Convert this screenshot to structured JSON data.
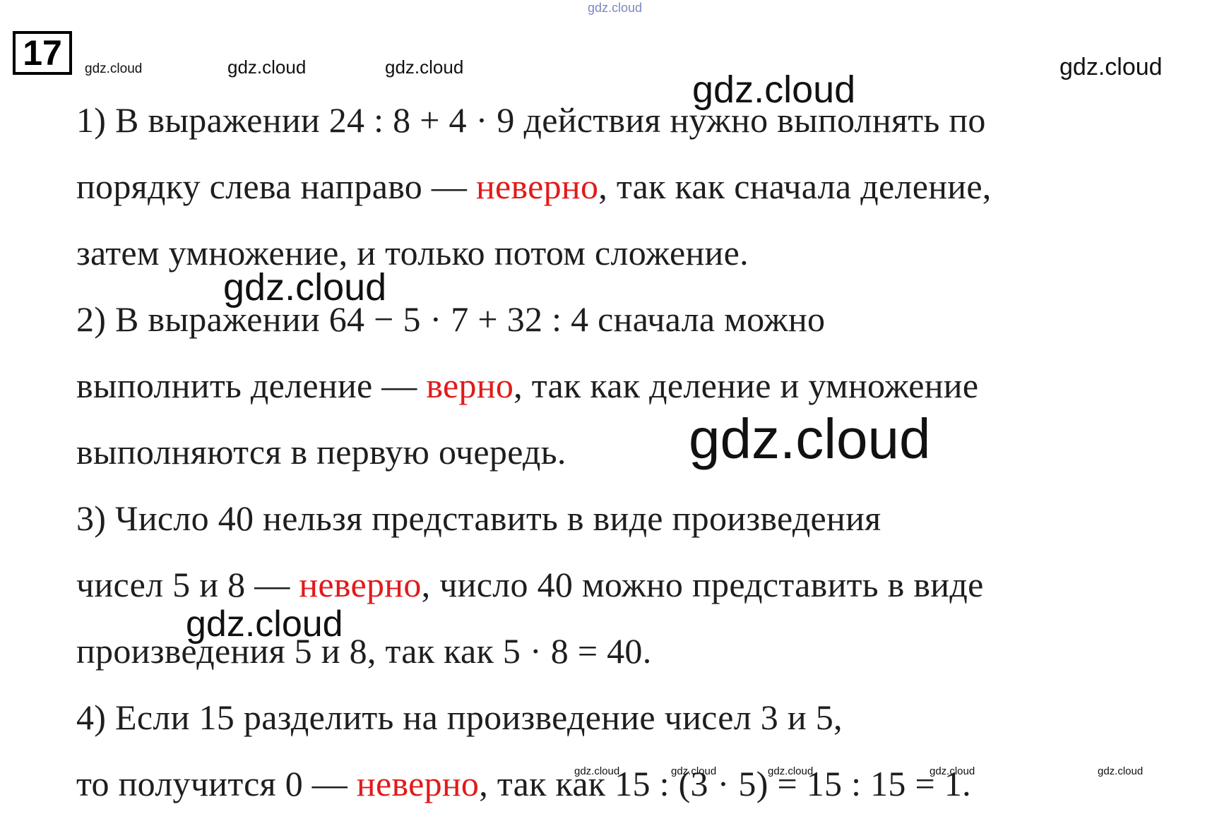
{
  "problem_number": "17",
  "watermark": "gdz.cloud",
  "lines": [
    {
      "parts": [
        {
          "text": "1) В выражении 24 : 8 + 4 · 9 действия нужно выполнять по",
          "red": false
        }
      ]
    },
    {
      "parts": [
        {
          "text": "порядку слева направо — ",
          "red": false
        },
        {
          "text": "неверно",
          "red": true
        },
        {
          "text": ", так как сначала деление,",
          "red": false
        }
      ]
    },
    {
      "parts": [
        {
          "text": "затем умножение, и только потом сложение.",
          "red": false
        }
      ]
    },
    {
      "parts": [
        {
          "text": "2) В выражении 64 − 5 · 7 + 32 : 4 сначала можно",
          "red": false
        }
      ]
    },
    {
      "parts": [
        {
          "text": "выполнить деление — ",
          "red": false
        },
        {
          "text": "верно",
          "red": true
        },
        {
          "text": ", так как деление и умножение",
          "red": false
        }
      ]
    },
    {
      "parts": [
        {
          "text": "выполняются в первую очередь.",
          "red": false
        }
      ]
    },
    {
      "parts": [
        {
          "text": "3) Число 40 нельзя представить в виде произведения",
          "red": false
        }
      ]
    },
    {
      "parts": [
        {
          "text": "чисел 5 и 8 — ",
          "red": false
        },
        {
          "text": "неверно",
          "red": true
        },
        {
          "text": ", число 40 можно представить в виде",
          "red": false
        }
      ]
    },
    {
      "parts": [
        {
          "text": "произведения 5 и 8, так как 5 · 8 = 40.",
          "red": false
        }
      ]
    },
    {
      "parts": [
        {
          "text": "4) Если 15 разделить на произведение чисел 3 и 5,",
          "red": false
        }
      ]
    },
    {
      "parts": [
        {
          "text": "то получится 0 — ",
          "red": false
        },
        {
          "text": "неверно",
          "red": true
        },
        {
          "text": ", так как 15 : (3 · 5) = 15 : 15 = 1.",
          "red": false
        }
      ]
    }
  ]
}
